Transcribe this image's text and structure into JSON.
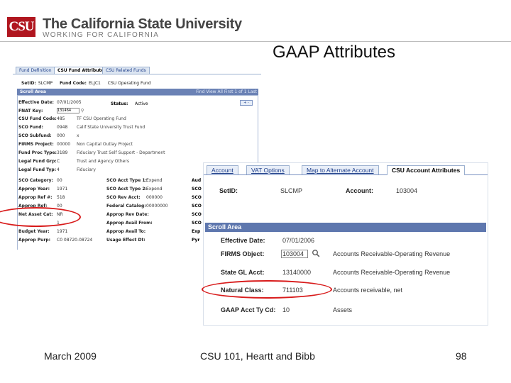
{
  "header": {
    "logo_text": "CSU",
    "university": "The California State University",
    "tagline": "WORKING FOR CALIFORNIA"
  },
  "slide_title": "GAAP Attributes",
  "screenshot1": {
    "tabs": [
      "Fund Definition",
      "CSU Fund Attributes",
      "CSU Related Funds"
    ],
    "keys": [
      {
        "label": "SetID:",
        "value": "SLCMP"
      },
      {
        "label": "Fund Code:",
        "value": "ELJC1"
      },
      {
        "label": "",
        "value": "CSU Operating Fund"
      }
    ],
    "scroll_area": "Scroll Area",
    "nav_text": "Find View All   First  1 of 1  Last",
    "status_label": "Status:",
    "status_value": "Active",
    "plus_minus": "+ -",
    "left_rows": [
      {
        "label": "Effective Date:",
        "value": "07/01/2005",
        "desc": ""
      },
      {
        "label": "FNAT Key:",
        "value": "131464",
        "desc": ""
      },
      {
        "label": "CSU Fund Code:",
        "value": "485",
        "desc": "TF CSU Operating Fund"
      },
      {
        "label": "SCO Fund:",
        "value": "0948",
        "desc": "Calif State University Trust Fund"
      },
      {
        "label": "SCO Subfund:",
        "value": "000",
        "desc": "x"
      },
      {
        "label": "FIRMS Project:",
        "value": "00000",
        "desc": "Non Capital Outlay Project"
      },
      {
        "label": "Fund Proc Type:",
        "value": "3189",
        "desc": "Fiduciary Trust Self Support - Department"
      },
      {
        "label": "Legal Fund Grp:",
        "value": "C",
        "desc": "Trust and Agency Others"
      },
      {
        "label": "Legal Fund Typ:",
        "value": "4",
        "desc": "Fiduciary"
      },
      {
        "label": "SCO Category:",
        "value": "00",
        "desc": ""
      },
      {
        "label": "Approp Year:",
        "value": "1971",
        "desc": ""
      },
      {
        "label": "Approp Ref #:",
        "value": "518",
        "desc": ""
      },
      {
        "label": "Approp Ref:",
        "value": "00",
        "desc": ""
      },
      {
        "label": "Net Asset Cat:",
        "value": "NR",
        "desc": ""
      },
      {
        "label": "",
        "value": "1",
        "desc": ""
      },
      {
        "label": "Budget Year:",
        "value": "1971",
        "desc": ""
      },
      {
        "label": "Approp Purp:",
        "value": "C0 08720-08724",
        "desc": ""
      }
    ],
    "right_rows": [
      {
        "label": "SCO Acct Type 1:",
        "value": "Expend"
      },
      {
        "label": "SCO Acct Type 2:",
        "value": "Expend"
      },
      {
        "label": "SCO Rev Acct:",
        "value": "000000"
      },
      {
        "label": "Federal Catalog:",
        "value": "00000000"
      },
      {
        "label": "Approp Rev Date:",
        "value": ""
      },
      {
        "label": "Approp Avail From:",
        "value": ""
      },
      {
        "label": "Approp Avail To:",
        "value": ""
      },
      {
        "label": "Usage Effect Dt:",
        "value": ""
      }
    ],
    "right_edge_col": [
      "Aud",
      "SCO",
      "SCO",
      "SCO",
      "SCO",
      "SCO",
      "Exp",
      "Pyr"
    ]
  },
  "screenshot2": {
    "tabs": [
      "Account",
      "VAT Options",
      "Map to Alternate Account",
      "CSU Account Attributes"
    ],
    "setid_label": "SetID:",
    "setid_value": "SLCMP",
    "account_label": "Account:",
    "account_value": "103004",
    "scroll_area": "Scroll Area",
    "fields": [
      {
        "label": "Effective Date:",
        "value": "07/01/2006",
        "desc": ""
      },
      {
        "label": "FIRMS Object:",
        "value": "103004",
        "desc": "Accounts Receivable-Operating Revenue"
      },
      {
        "label": "State GL Acct:",
        "value": "13140000",
        "desc": "Accounts Receivable-Operating Revenue"
      },
      {
        "label": "Natural Class:",
        "value": "711103",
        "desc": "Accounts receivable, net"
      },
      {
        "label": "GAAP Acct Ty Cd:",
        "value": "10",
        "desc": "Assets"
      }
    ]
  },
  "footer": {
    "date": "March 2009",
    "course": "CSU 101, Heartt and Bibb",
    "page": "98"
  },
  "colors": {
    "csu_red": "#b0161f",
    "scroll_header": "#5e77ae",
    "highlight_oval": "#d81b1b"
  }
}
